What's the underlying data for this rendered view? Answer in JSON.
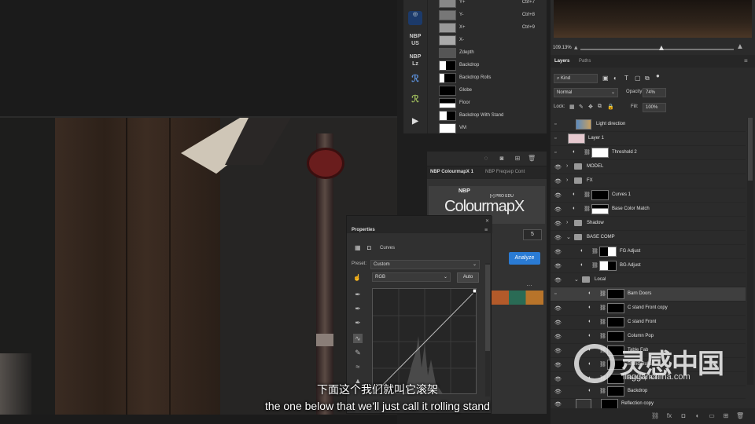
{
  "channels": [
    {
      "label": "Y+",
      "shortcut": "Ctrl+7"
    },
    {
      "label": "Y-",
      "shortcut": "Ctrl+8"
    },
    {
      "label": "X+",
      "shortcut": "Ctrl+9"
    },
    {
      "label": "X-",
      "shortcut": ""
    },
    {
      "label": "Zdepth",
      "shortcut": ""
    },
    {
      "label": "Backdrop",
      "shortcut": ""
    },
    {
      "label": "Backdrop Rolls",
      "shortcut": ""
    },
    {
      "label": "Globe",
      "shortcut": ""
    },
    {
      "label": "Floor",
      "shortcut": ""
    },
    {
      "label": "Backdrop With Stand",
      "shortcut": ""
    },
    {
      "label": "VM",
      "shortcut": ""
    }
  ],
  "toolstrip": {
    "items": [
      "NBP US",
      "NBP Lz"
    ]
  },
  "nbp": {
    "tab1": "NBP ColourmapX 1",
    "tab2": "NBP Freqsep Cont",
    "logo_top": "NBP",
    "logo_main": "ColourmapX",
    "logo_sub": "[+] PRO EDU",
    "number": "5",
    "analyze": "Analyze",
    "dots": "…"
  },
  "properties": {
    "title": "Properties",
    "type": "Curves",
    "preset_label": "Preset:",
    "preset_value": "Custom",
    "channel_value": "RGB",
    "auto": "Auto"
  },
  "navigator": {
    "zoom": "109.13%"
  },
  "layers_panel": {
    "tab_layers": "Layers",
    "tab_paths": "Paths",
    "kind": "Kind",
    "blend": "Normal",
    "opacity_label": "Opacity:",
    "opacity_value": "74%",
    "lock_label": "Lock:",
    "fill_label": "Fill:",
    "fill_value": "100%",
    "layers": [
      {
        "label": "Light direction",
        "kind": "image"
      },
      {
        "label": "Layer 1",
        "kind": "image"
      },
      {
        "label": "Threshold 2",
        "kind": "adjust"
      },
      {
        "label": "MODEL",
        "kind": "folder"
      },
      {
        "label": "FX",
        "kind": "folder"
      },
      {
        "label": "Curves 1",
        "kind": "adjust"
      },
      {
        "label": "Base Color Match",
        "kind": "adjust"
      },
      {
        "label": "Shadow",
        "kind": "folder"
      },
      {
        "label": "BASE COMP",
        "kind": "folder"
      },
      {
        "label": "FG Adjust",
        "kind": "adjust"
      },
      {
        "label": "BG Adjust",
        "kind": "adjust"
      },
      {
        "label": "Local",
        "kind": "folder"
      },
      {
        "label": "Barn Doors",
        "kind": "adjust"
      },
      {
        "label": "C stand Front copy",
        "kind": "adjust"
      },
      {
        "label": "C stand Front",
        "kind": "adjust"
      },
      {
        "label": "Column Pop",
        "kind": "adjust"
      },
      {
        "label": "Table Fab",
        "kind": "adjust"
      },
      {
        "label": "Stand Rolls",
        "kind": "adjust"
      },
      {
        "label": "Backdrop Rolls",
        "kind": "adjust"
      },
      {
        "label": "Backdrop",
        "kind": "adjust"
      },
      {
        "label": "Reflection copy",
        "kind": "image"
      }
    ]
  },
  "subtitles": {
    "zh": "下面这个我们就叫它滚架",
    "en": "the one below that we'll just call it rolling stand"
  },
  "watermark": {
    "text": "灵感中国",
    "url": "lingganchina.com"
  }
}
